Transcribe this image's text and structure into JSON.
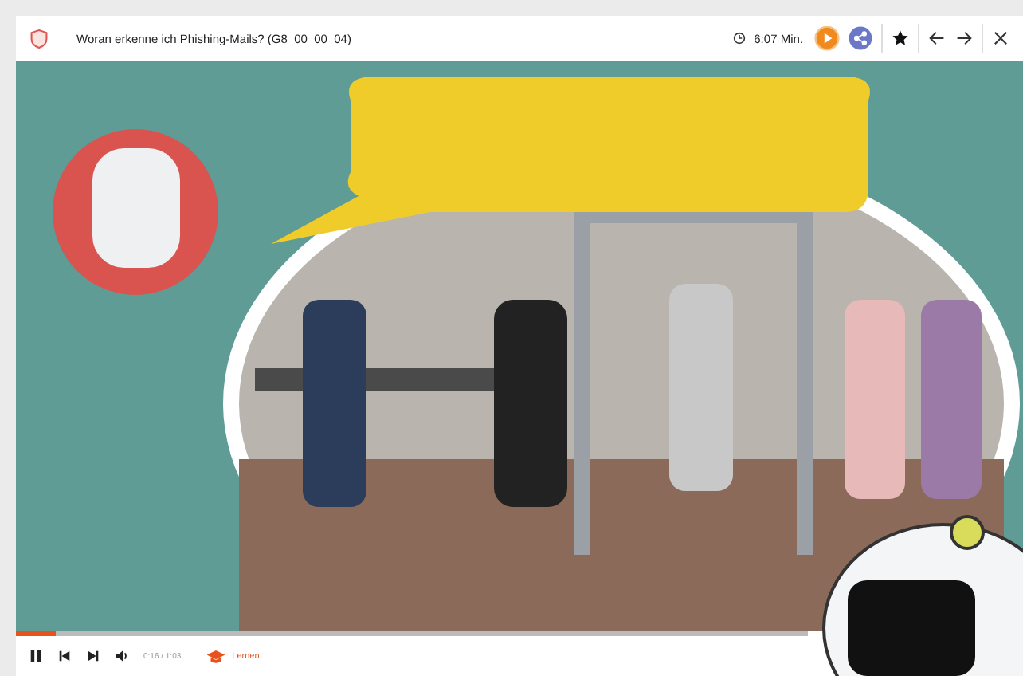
{
  "header": {
    "title": "Woran erkenne ich Phishing-Mails? (G8_00_00_04)",
    "duration": "6:07 Min."
  },
  "player": {
    "progress": {
      "level": 0.05
    },
    "time": "0:16 / 1:03",
    "learn_label": "Lernen"
  }
}
